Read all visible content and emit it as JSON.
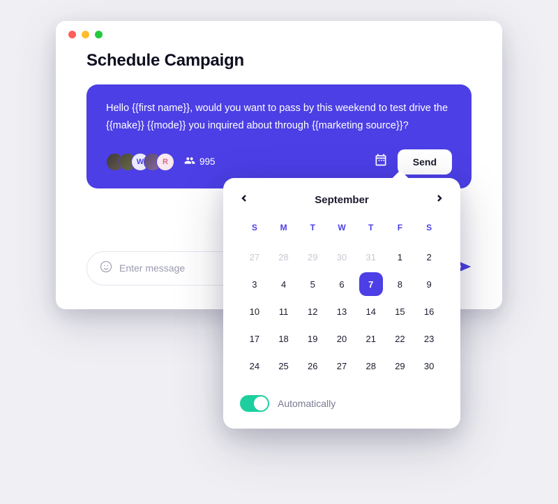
{
  "header": {
    "title": "Schedule Campaign"
  },
  "card": {
    "message": "Hello {{first name}}, would you want to pass by this weekend to test drive the {{make}} {{mode}} you inquired about through  {{marketing source}}?",
    "avatars": [
      {
        "label": ""
      },
      {
        "label": ""
      },
      {
        "label": "W"
      },
      {
        "label": ""
      },
      {
        "label": "R"
      }
    ],
    "group_count": "995",
    "send_label": "Send"
  },
  "compose": {
    "placeholder": "Enter message"
  },
  "calendar": {
    "month": "September",
    "dow": [
      "S",
      "M",
      "T",
      "W",
      "T",
      "F",
      "S"
    ],
    "leading": [
      "27",
      "28",
      "29",
      "30",
      "31"
    ],
    "days": [
      "1",
      "2",
      "3",
      "4",
      "5",
      "6",
      "7",
      "8",
      "9",
      "10",
      "11",
      "12",
      "13",
      "14",
      "15",
      "16",
      "17",
      "18",
      "19",
      "20",
      "21",
      "22",
      "23",
      "24",
      "25",
      "26",
      "27",
      "28",
      "29",
      "30"
    ],
    "selected": "7",
    "auto_label": "Automatically",
    "auto_on": true
  },
  "icons": {
    "calendar": "calendar-icon",
    "group": "people-icon",
    "emoji": "emoji-icon",
    "video": "video-icon",
    "send": "paper-plane-icon",
    "prev": "chevron-left-icon",
    "next": "chevron-right-icon"
  }
}
